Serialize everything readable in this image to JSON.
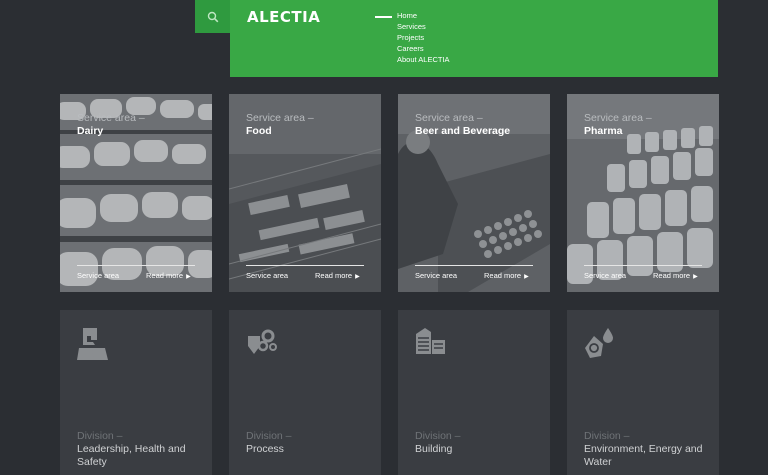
{
  "header": {
    "logo_text": "ALECTIA",
    "nav": [
      "Home",
      "Services",
      "Projects",
      "Careers",
      "About ALECTIA"
    ]
  },
  "service_areas": [
    {
      "kicker": "Service area –",
      "title": "Dairy",
      "link_left": "Service area",
      "link_right": "Read more",
      "icon": "cheese-shelves-photo"
    },
    {
      "kicker": "Service area –",
      "title": "Food",
      "link_left": "Service area",
      "link_right": "Read more",
      "icon": "factory-aerial-photo"
    },
    {
      "kicker": "Service area –",
      "title": "Beer and Beverage",
      "link_left": "Service area",
      "link_right": "Read more",
      "icon": "bottling-line-photo"
    },
    {
      "kicker": "Service area –",
      "title": "Pharma",
      "link_left": "Service area",
      "link_right": "Read more",
      "icon": "vials-photo"
    }
  ],
  "divisions": [
    {
      "kicker": "Division –",
      "title": "Leadership, Health and Safety",
      "icon": "leadership-icon"
    },
    {
      "kicker": "Division –",
      "title": "Process",
      "icon": "process-icon"
    },
    {
      "kicker": "Division –",
      "title": "Building",
      "icon": "building-icon"
    },
    {
      "kicker": "Division –",
      "title": "Environment, Energy and Water",
      "icon": "environment-icon"
    }
  ],
  "colors": {
    "brand_green": "#39a845",
    "search_green": "#2f9a3f",
    "background": "#2b2e33",
    "division_card": "#3a3d42"
  }
}
